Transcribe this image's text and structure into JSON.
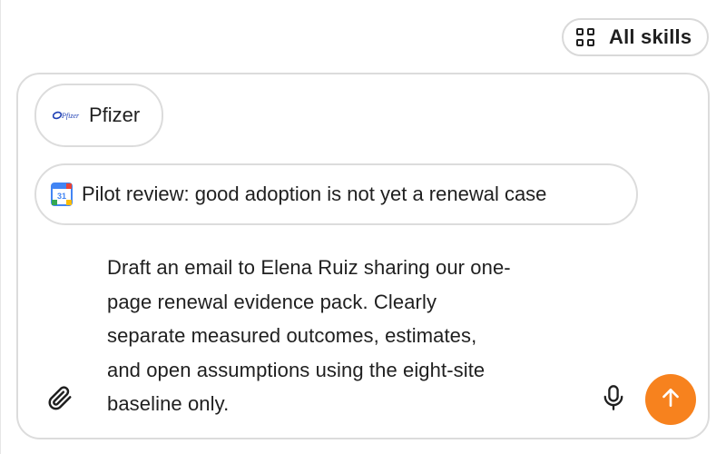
{
  "header": {
    "all_skills_label": "All skills",
    "all_skills_icon": "grid-icon"
  },
  "composer": {
    "chips": [
      {
        "label": "Pfizer",
        "icon": "pfizer-logo"
      },
      {
        "label": "Pilot review: good adoption is not yet a renewal case",
        "icon": "google-calendar-icon",
        "icon_text": "31"
      }
    ],
    "message": "Draft an email to Elena Ruiz sharing our one-\npage renewal evidence pack. Clearly\nseparate measured outcomes, estimates,\nand open assumptions using the eight-site\nbaseline only.",
    "attach_icon": "paperclip-icon",
    "mic_icon": "microphone-icon",
    "send_icon": "arrow-up-icon"
  },
  "colors": {
    "accent": "#f7821e",
    "border": "#dcdcdc",
    "text": "#1f1f1f"
  }
}
